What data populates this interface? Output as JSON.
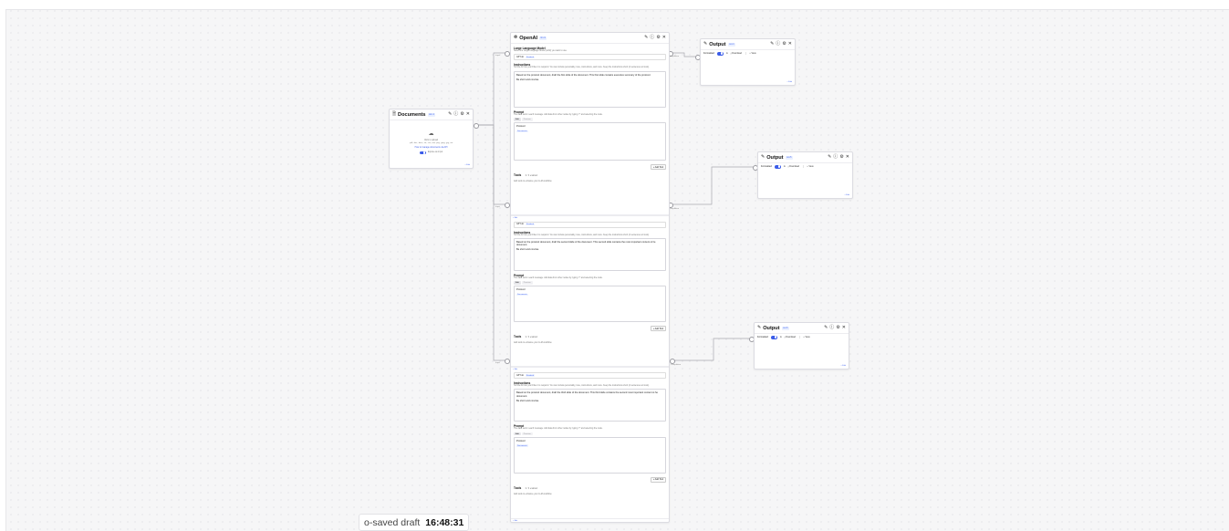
{
  "app": {
    "autosave_text": "o-saved draft",
    "autosave_time": "16:48:31"
  },
  "documents_node": {
    "title": "Documents",
    "version": "doc-4",
    "upload_text": "Click to upload",
    "filetypes": ".pdf, .doc, .docx, .txt, .csv, .md, .png, .jpeg, .jpg, .etc",
    "manage_link": "How to manage documents via API",
    "expose_label": "Expose as input",
    "footer": "+ Edit"
  },
  "openai_node": {
    "title": "OpenAI",
    "version": "llm-9",
    "model_heading": "Large Language Model",
    "model_desc": "Select the Large Language Model (LLM) you want to use.",
    "model_value": "GPT-4o",
    "model_badge": "Standard",
    "instructions_heading": "Instructions",
    "instructions_desc": "Tell the AI how you'd like it to respond. You can include personality, tone, instructions, and more. Keep the instructions short (4 sentences at most).",
    "prompt_heading": "Prompt",
    "prompt_desc": "The data sent in each message. Add data from other nodes by typing \"/\" and selecting the node.",
    "tab_edit": "Edit",
    "tab_preview": "Preview",
    "prompt_text": "Protocol",
    "prompt_chip": "Documents",
    "tools_heading": "Tools",
    "tools_count": "0 / 3 enabled",
    "tools_desc": "Add tools to enhance your LLM workflow.",
    "add_tool": "+ Add Tool",
    "edit_link": "+ Edit",
    "sections": [
      {
        "instruction": "Based on the protocol document, draft the first slide of the document. This first slide contains executive summary of the protocol.",
        "concise": "Be short and concise."
      },
      {
        "instruction": "Based on the protocol document, draft the second slide of the document. This second slide contains the most important content ot he document.",
        "concise": "Be short and concise."
      },
      {
        "instruction": "Based on the protocol document, draft the third slide of the document. This third slide contains the second most important content ot he document.",
        "concise": "Be short and concise."
      }
    ]
  },
  "output_nodes": [
    {
      "title": "Output",
      "version": "out-4"
    },
    {
      "title": "Output",
      "version": "out-5"
    },
    {
      "title": "Output",
      "version": "out-6"
    }
  ],
  "output_common": {
    "formatted": "Formatted",
    "download": "Download",
    "view": "View",
    "footer": "+ Edit"
  },
  "wire_labels": {
    "input": "Input",
    "completion": "Completion"
  }
}
